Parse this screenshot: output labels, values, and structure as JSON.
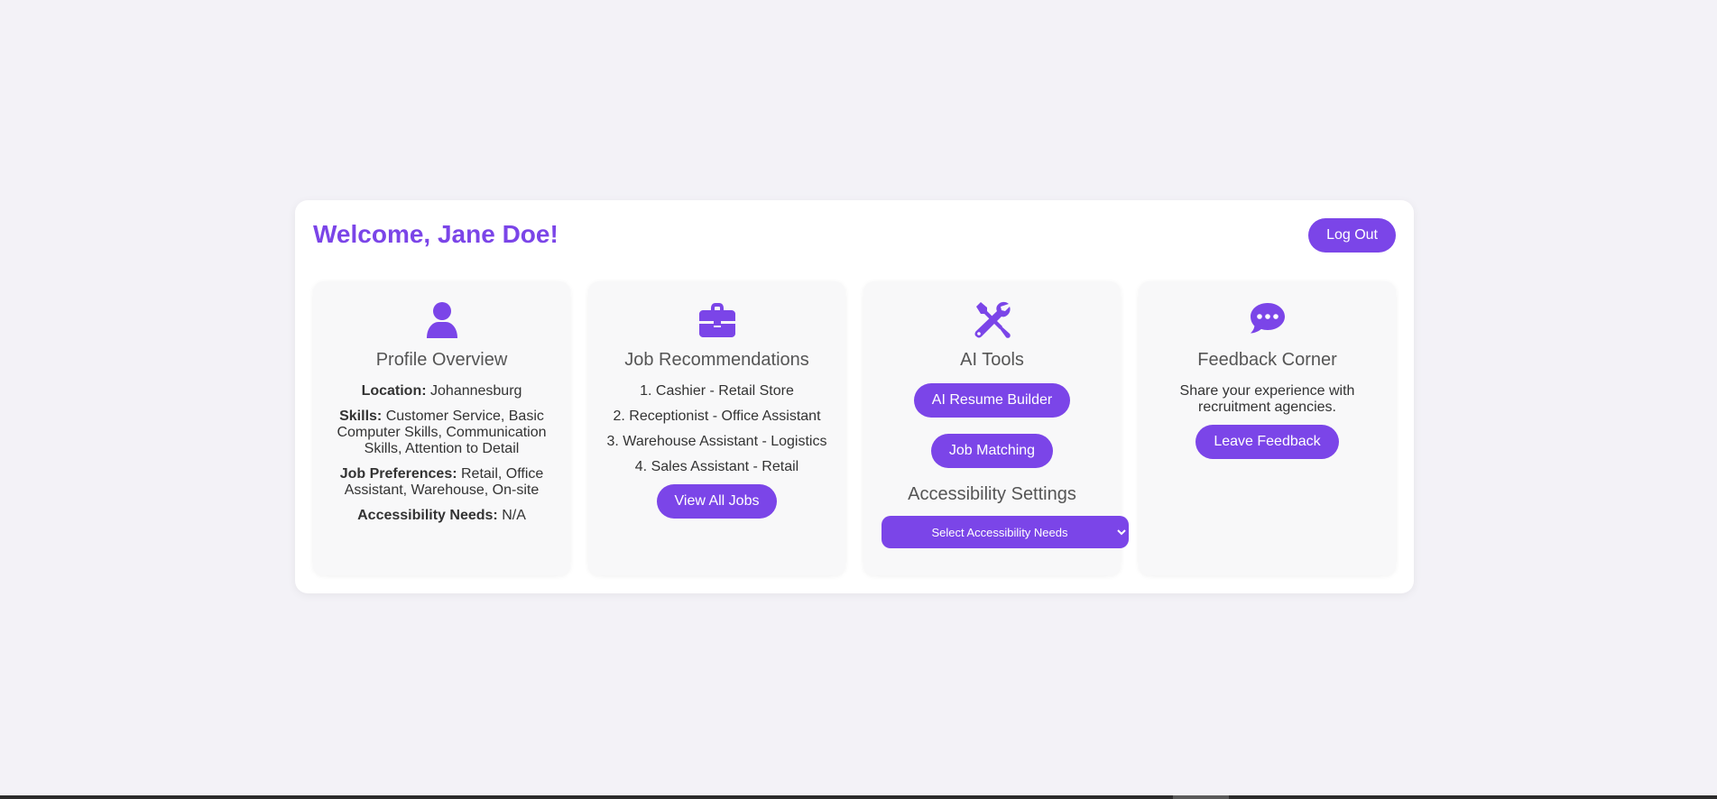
{
  "header": {
    "welcome": "Welcome, Jane Doe!",
    "logout_label": "Log Out"
  },
  "colors": {
    "accent": "#7b45e8",
    "page_bg": "#f3f2f7",
    "card_bg": "#f8f8f9"
  },
  "profile": {
    "icon": "user-icon",
    "title": "Profile Overview",
    "location_label": "Location:",
    "location_value": "Johannesburg",
    "skills_label": "Skills:",
    "skills_value": "Customer Service, Basic Computer Skills, Communication Skills, Attention to Detail",
    "prefs_label": "Job Preferences:",
    "prefs_value": "Retail, Office Assistant, Warehouse, On-site",
    "access_label": "Accessibility Needs:",
    "access_value": "N/A"
  },
  "jobs": {
    "icon": "briefcase-icon",
    "title": "Job Recommendations",
    "items": [
      "1. Cashier - Retail Store",
      "2. Receptionist - Office Assistant",
      "3. Warehouse Assistant - Logistics",
      "4. Sales Assistant - Retail"
    ],
    "view_all_label": "View All Jobs"
  },
  "tools": {
    "icon": "tools-icon",
    "title": "AI Tools",
    "resume_label": "AI Resume Builder",
    "matching_label": "Job Matching",
    "access_title": "Accessibility Settings",
    "select_value": "Select Accessibility Needs"
  },
  "feedback": {
    "icon": "comment-dots-icon",
    "title": "Feedback Corner",
    "text": "Share your experience with recruitment agencies.",
    "button_label": "Leave Feedback"
  }
}
